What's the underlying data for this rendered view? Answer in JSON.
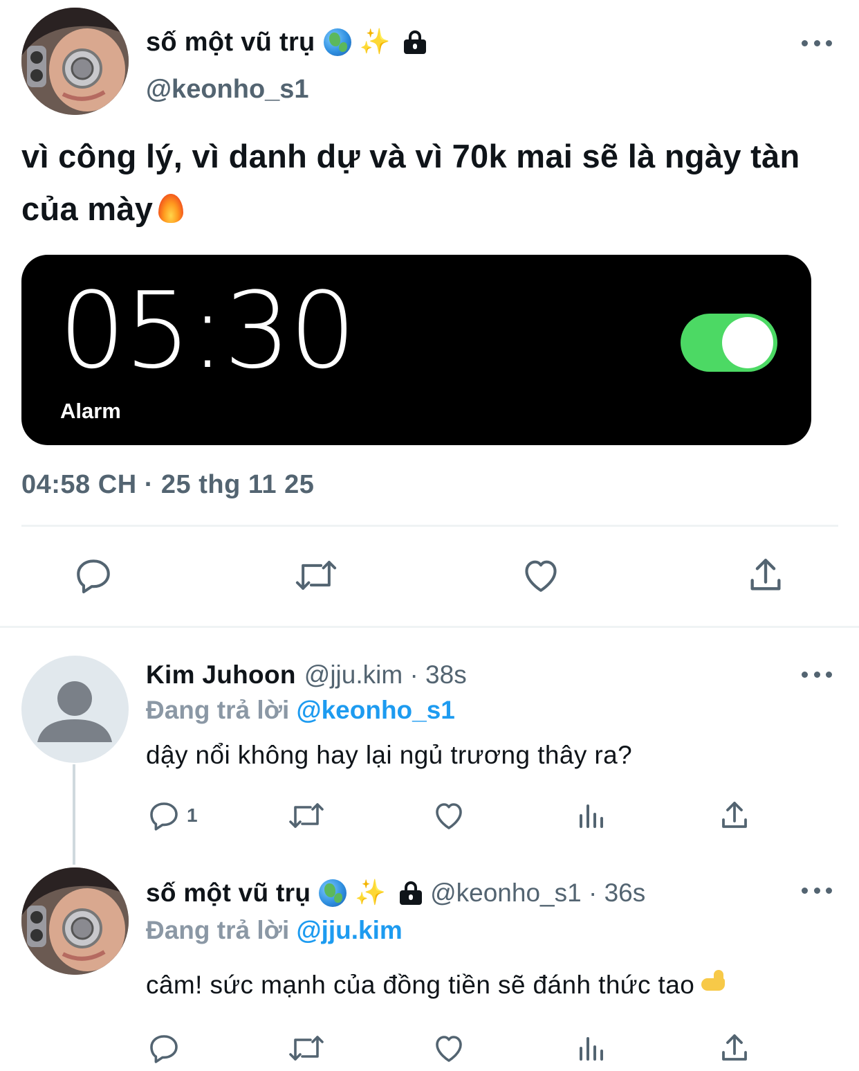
{
  "main_tweet": {
    "author_name": "số một vũ trụ",
    "author_handle": "@keonho_s1",
    "badges": [
      "globe-emoji",
      "sparkles-emoji",
      "lock-icon"
    ],
    "text": "vì công lý, vì danh dự và vì 70k mai sẽ là ngày tàn của mày",
    "text_emoji": "fire-emoji",
    "media": {
      "alarm_time": "05:30",
      "alarm_label": "Alarm",
      "toggle_on": true,
      "toggle_color": "#4cd964"
    },
    "timestamp": "04:58 CH · 25 thg 11 25",
    "actions": [
      "reply-icon",
      "retweet-icon",
      "like-icon",
      "share-icon"
    ]
  },
  "replies": [
    {
      "author_name": "Kim Juhoon",
      "meta": "@jju.kim · 38s",
      "replying_prefix": "Đang trả lời",
      "replying_to": "@keonho_s1",
      "text": "dậy nổi không hay lại ngủ trương thây ra?",
      "reply_count": "1",
      "actions": [
        "reply-icon",
        "retweet-icon",
        "like-icon",
        "views-icon",
        "share-icon"
      ]
    },
    {
      "author_name": "số một vũ trụ",
      "meta": "@keonho_s1 · 36s",
      "replying_prefix": "Đang trả lời",
      "replying_to": "@jju.kim",
      "text": "câm! sức mạnh của đồng tiền sẽ đánh thức tao",
      "text_emoji": "flexed-biceps-emoji",
      "actions": [
        "reply-icon",
        "retweet-icon",
        "like-icon",
        "views-icon",
        "share-icon"
      ]
    }
  ],
  "colors": {
    "text": "#0f1419",
    "secondary": "#536471",
    "link": "#1d9bf0",
    "divider": "#eff3f4"
  }
}
